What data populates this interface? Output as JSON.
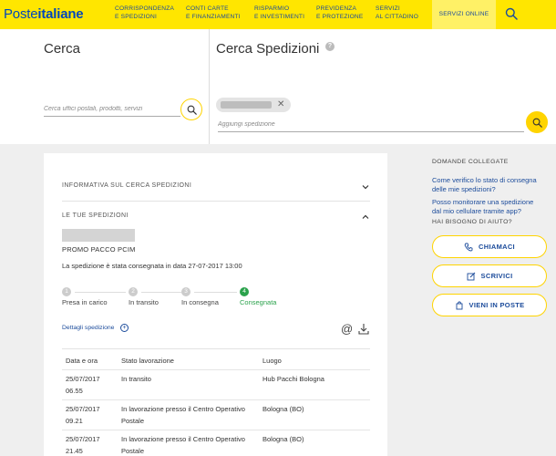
{
  "header": {
    "logo_light": "Poste",
    "logo_bold": "italiane",
    "nav": [
      {
        "line1": "CORRISPONDENZA",
        "line2": "E SPEDIZIONI"
      },
      {
        "line1": "CONTI CARTE",
        "line2": "E FINANZIAMENTI"
      },
      {
        "line1": "RISPARMIO",
        "line2": "E INVESTIMENTI"
      },
      {
        "line1": "PREVIDENZA",
        "line2": "E PROTEZIONE"
      },
      {
        "line1": "SERVIZI",
        "line2": "AL CITTADINO"
      }
    ],
    "online_label": "SERVIZI ONLINE",
    "search_icon": "search-icon"
  },
  "cerca": {
    "title": "Cerca",
    "placeholder": "Cerca uffici postali, prodotti, servizi"
  },
  "spedizioni": {
    "title": "Cerca Spedizioni",
    "help": "?",
    "chip_remove": "✕",
    "add_placeholder": "Aggiungi spedizione"
  },
  "card": {
    "informativa": "INFORMATIVA SUL CERCA SPEDIZIONI",
    "tue_spedizioni": "LE TUE SPEDIZIONI",
    "product": "PROMO PACCO PCIM",
    "status_text": "La spedizione è stata consegnata in data 27-07-2017 13:00",
    "steps": [
      {
        "num": "1",
        "label": "Presa in carico"
      },
      {
        "num": "2",
        "label": "In transito"
      },
      {
        "num": "3",
        "label": "In consegna"
      },
      {
        "num": "4",
        "label": "Consegnata"
      }
    ],
    "dettagli": "Dettagli spedizione",
    "dettagli_plus": "+",
    "email_glyph": "@",
    "table": {
      "headers": [
        "Data e ora",
        "Stato lavorazione",
        "Luogo"
      ],
      "rows": [
        {
          "date": "25/07/2017",
          "time": "06.55",
          "stato1": "In transito",
          "stato2": "",
          "luogo": "Hub Pacchi Bologna"
        },
        {
          "date": "25/07/2017",
          "time": "09.21",
          "stato1": "In lavorazione presso il Centro Operativo",
          "stato2": "Postale",
          "luogo": "Bologna (BO)"
        },
        {
          "date": "25/07/2017",
          "time": "21.45",
          "stato1": "In lavorazione presso il Centro Operativo",
          "stato2": "Postale",
          "luogo": "Bologna (BO)"
        }
      ]
    }
  },
  "sidebar": {
    "domande_heading": "DOMANDE COLLEGATE",
    "links": [
      {
        "line1": "Come verifico lo stato di consegna",
        "line2": "delle mie spedizioni?"
      },
      {
        "line1": "Posso monitorare una spedizione",
        "line2": "dal mio cellulare tramite app?"
      }
    ],
    "aiuto_heading": "HAI BISOGNO DI AIUTO?",
    "buttons": [
      {
        "label": "CHIAMACI",
        "icon": "phone-icon"
      },
      {
        "label": "SCRIVICI",
        "icon": "write-icon"
      },
      {
        "label": "VIENI IN POSTE",
        "icon": "location-icon"
      }
    ]
  },
  "colors": {
    "brand_yellow": "#ffe600",
    "accent_yellow": "#ffd400",
    "link_blue": "#1b4b9b",
    "success_green": "#2ba24c"
  }
}
